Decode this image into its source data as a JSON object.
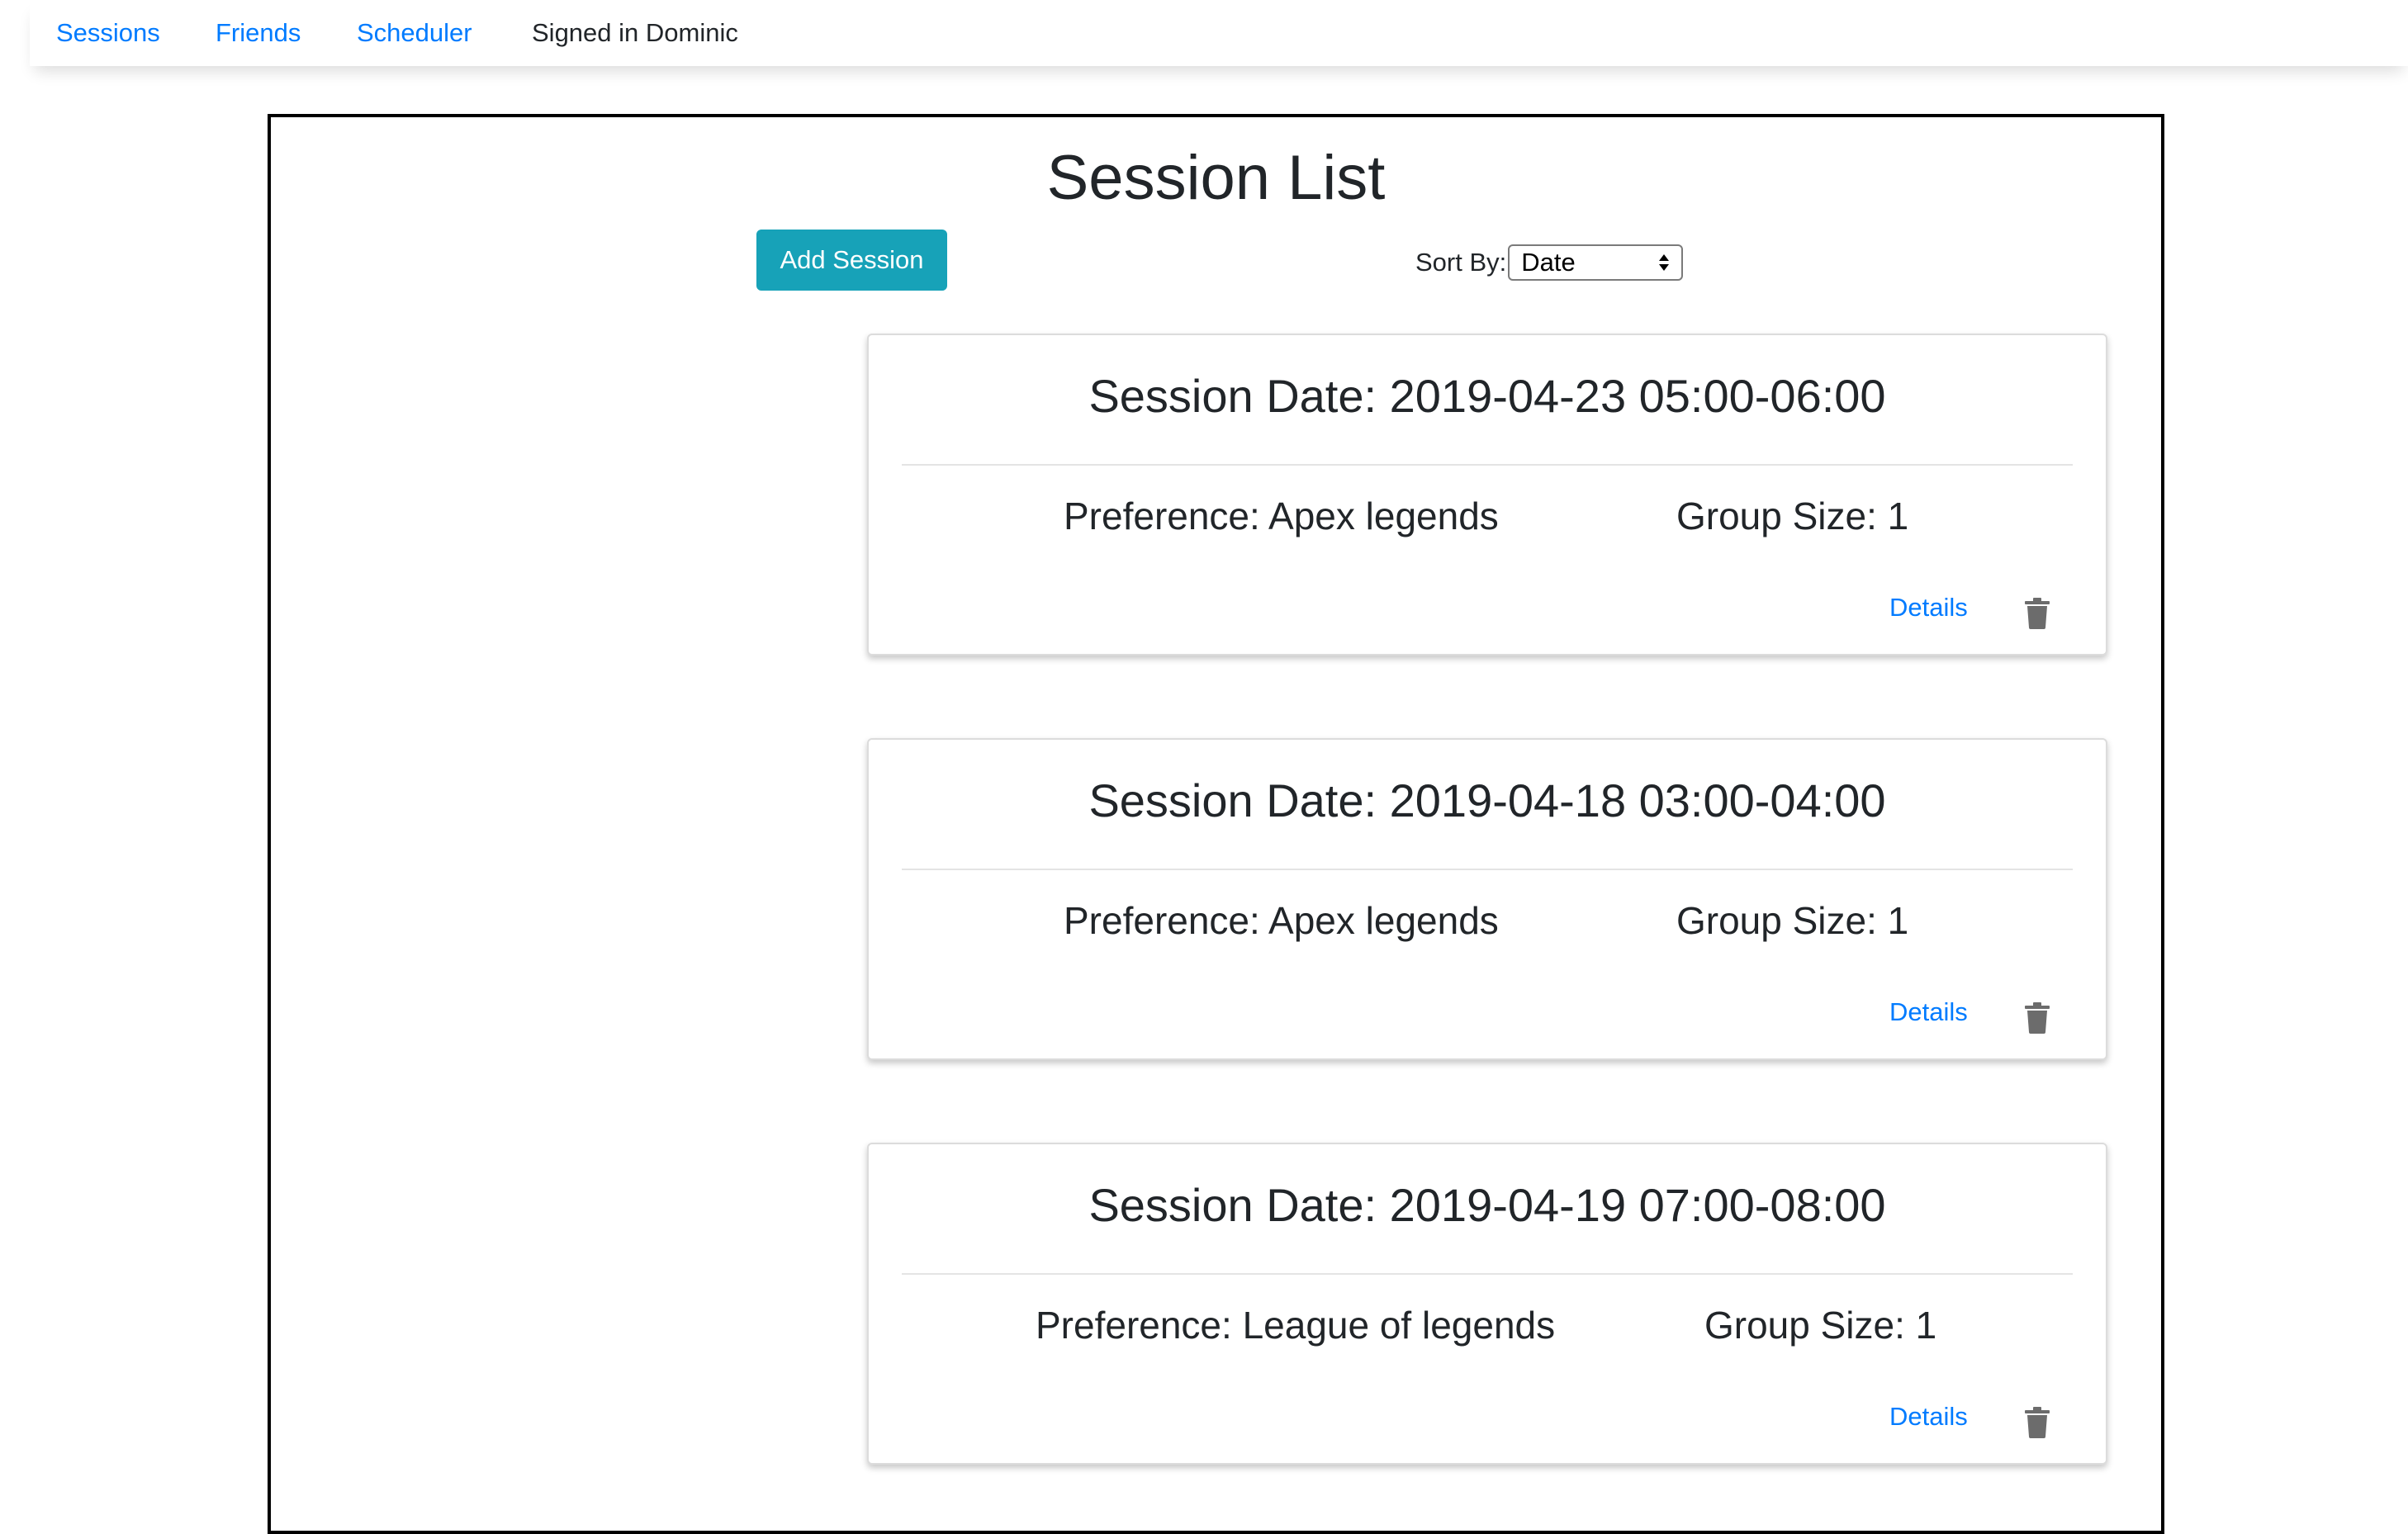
{
  "nav": {
    "sessions": "Sessions",
    "friends": "Friends",
    "scheduler": "Scheduler",
    "signed_in": "Signed in Dominic"
  },
  "page": {
    "title": "Session List",
    "add_button": "Add Session",
    "sort_label": "Sort By:",
    "sort_value": "Date"
  },
  "sessions": [
    {
      "date_text": "Session Date: 2019-04-23 05:00-06:00",
      "preference": "Preference: Apex legends",
      "group_size": "Group Size: 1",
      "details": "Details"
    },
    {
      "date_text": "Session Date: 2019-04-18 03:00-04:00",
      "preference": "Preference: Apex legends",
      "group_size": "Group Size: 1",
      "details": "Details"
    },
    {
      "date_text": "Session Date: 2019-04-19 07:00-08:00",
      "preference": "Preference: League of legends",
      "group_size": "Group Size: 1",
      "details": "Details"
    }
  ],
  "icons": {
    "delete": "trash-icon",
    "select": "chevron-updown-icon"
  },
  "colors": {
    "link": "#007bff",
    "accent_button": "#17a2b8",
    "text": "#212529",
    "icon": "#6c6c6c"
  }
}
